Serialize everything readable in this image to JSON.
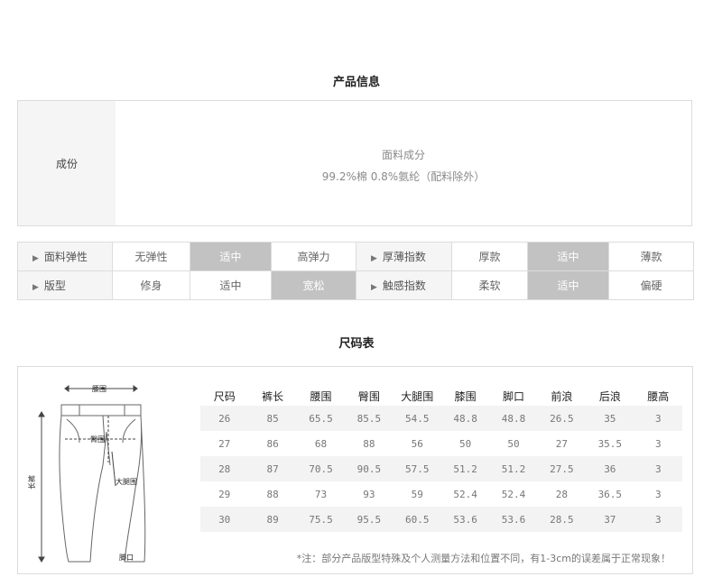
{
  "product_info": {
    "title": "产品信息",
    "composition_label": "成份",
    "fabric_heading": "面料成分",
    "fabric_detail": "99.2%棉  0.8%氨纶（配料除外）"
  },
  "attributes": {
    "rows": [
      {
        "left_label": "面料弹性",
        "left_options": [
          {
            "text": "无弹性",
            "active": false
          },
          {
            "text": "适中",
            "active": true
          },
          {
            "text": "高弹力",
            "active": false
          }
        ],
        "right_label": "厚薄指数",
        "right_options": [
          {
            "text": "厚款",
            "active": false
          },
          {
            "text": "适中",
            "active": true
          },
          {
            "text": "薄款",
            "active": false
          }
        ]
      },
      {
        "left_label": "版型",
        "left_options": [
          {
            "text": "修身",
            "active": false
          },
          {
            "text": "适中",
            "active": false
          },
          {
            "text": "宽松",
            "active": true
          }
        ],
        "right_label": "触感指数",
        "right_options": [
          {
            "text": "柔软",
            "active": false
          },
          {
            "text": "适中",
            "active": true
          },
          {
            "text": "偏硬",
            "active": false
          }
        ]
      }
    ]
  },
  "size_chart": {
    "title": "尺码表",
    "diagram_labels": {
      "waist": "腰围",
      "hip": "臀围",
      "thigh": "大腿围",
      "length": "长裤",
      "hem": "脚口"
    },
    "columns": [
      "尺码",
      "裤长",
      "腰围",
      "臀围",
      "大腿围",
      "膝围",
      "脚口",
      "前浪",
      "后浪",
      "腰高"
    ],
    "rows": [
      [
        "26",
        "85",
        "65.5",
        "85.5",
        "54.5",
        "48.8",
        "48.8",
        "26.5",
        "35",
        "3"
      ],
      [
        "27",
        "86",
        "68",
        "88",
        "56",
        "50",
        "50",
        "27",
        "35.5",
        "3"
      ],
      [
        "28",
        "87",
        "70.5",
        "90.5",
        "57.5",
        "51.2",
        "51.2",
        "27.5",
        "36",
        "3"
      ],
      [
        "29",
        "88",
        "73",
        "93",
        "59",
        "52.4",
        "52.4",
        "28",
        "36.5",
        "3"
      ],
      [
        "30",
        "89",
        "75.5",
        "95.5",
        "60.5",
        "53.6",
        "53.6",
        "28.5",
        "37",
        "3"
      ]
    ],
    "note": "*注：部分产品版型特殊及个人测量方法和位置不同，有1-3cm的误差属于正常现象！"
  },
  "colors": {
    "active_cell": "#c2c2c2",
    "label_bg": "#f5f5f5",
    "border": "#dcdcdc"
  }
}
